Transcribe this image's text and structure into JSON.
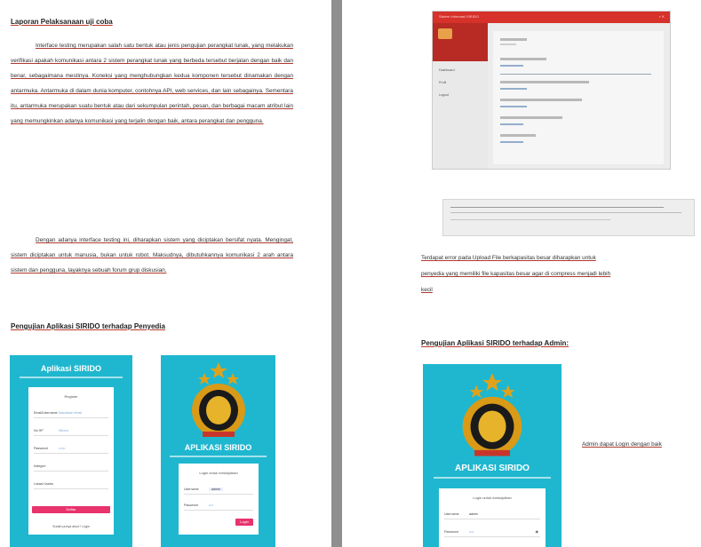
{
  "left_page": {
    "heading": "Laporan Pelaksanaan uji coba",
    "para1": [
      "Interface testing merupakan salah satu bentuk atau jenis pengujian",
      "perangkat lunak, yang melakukan verifikasi apakah komunikasi antara 2",
      "sistem perangkat lunak yang berbeda tersebut berjalan dengan baik dan",
      "benar, sebagaimana mestinya. Koneksi yang menghubungkan kedua",
      "komponen tersebut dinamakan dengan antarmuka. Antarmuka di dalam",
      "dunia komputer, contohnya API, web services, dan lain sebagainya.",
      "Sementara itu, antarmuka merupakan suatu bentuk atau dari sekumpulan",
      "perintah, pesan, dan berbagai macam atribut lain yang memungkinkan",
      "adanya komunikasi yang terjalin dengan baik, antara perangkat dan",
      "pengguna."
    ],
    "para2": [
      "Dengan adanya interface testing ini, diharapkan sistem yang",
      "diciptakan bersifat nyata. Mengingat, sistem diciptakan untuk manusia,",
      "bukan untuk robot. Maksudnya, dibutuhkannya komunikasi 2 arah antara",
      "sistem dan pengguna, layaknya sebuah forum grup diskusian."
    ],
    "section_heading": "Pengujian Aplikasi SIRIDO terhadap Penyedia",
    "phone1": {
      "title_prefix": "Aplikasi",
      "title_brand": "SIRIDO",
      "card_head": "Register",
      "fields": [
        {
          "label": "Email/Username",
          "value": "Masukkan email"
        },
        {
          "label": "No HP",
          "value": "08xxxx"
        },
        {
          "label": "Password",
          "value": "••••••"
        },
        {
          "label": "Kategori",
          "value": ""
        },
        {
          "label": "Lokasi Usaha",
          "value": ""
        }
      ],
      "button": "Daftar",
      "footer": "Sudah punya akun? Login"
    },
    "phone2": {
      "title_prefix": "APLIKASI",
      "title_brand": "SIRIDO",
      "card_head": "Login untuk melanjutkan",
      "fields": [
        {
          "label": "Username",
          "value": "admin"
        },
        {
          "label": "Password",
          "value": "••••"
        }
      ],
      "button": "Login"
    }
  },
  "right_page": {
    "desktop": {
      "window_title": "Sistem Informasi SIRIDO",
      "side_items": [
        "Dashboard",
        "Profil",
        "Logout"
      ]
    },
    "error_caption": [
      "Terdapat error pada Upload File berkapasitas besar diharapkan untuk",
      "penyedia yang memiliki file kapasitas besar agar di compress menjadi lebih",
      "kecil"
    ],
    "section_heading": "Pengujian Aplikasi SIRIDO terhadap Admin:",
    "admin_phone": {
      "title_prefix": "APLIKASI",
      "title_brand": "SIRIDO",
      "card_head": "Login untuk melanjutkan",
      "fields": [
        {
          "label": "Username",
          "value": "admin"
        },
        {
          "label": "Password",
          "value": "••••"
        }
      ]
    },
    "admin_note": "Admin dapat Login dengan baik"
  },
  "colors": {
    "phone_bg": "#1fb7cf",
    "accent_red": "#d7312b",
    "button_pink": "#e8336d",
    "divider": "#8f8f8f"
  }
}
